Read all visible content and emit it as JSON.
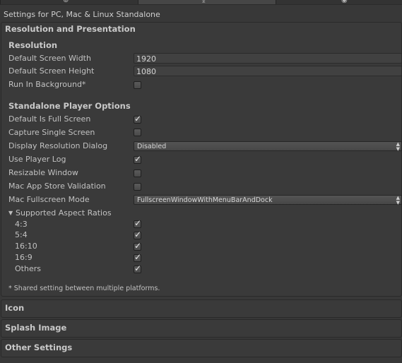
{
  "header": {
    "title": "Settings for PC, Mac & Linux Standalone"
  },
  "sections": {
    "resolution_presentation": "Resolution and Presentation",
    "icon": "Icon",
    "splash_image": "Splash Image",
    "other_settings": "Other Settings"
  },
  "resolution": {
    "heading": "Resolution",
    "default_width_label": "Default Screen Width",
    "default_width_value": "1920",
    "default_height_label": "Default Screen Height",
    "default_height_value": "1080",
    "run_in_background_label": "Run In Background*",
    "run_in_background": false
  },
  "standalone": {
    "heading": "Standalone Player Options",
    "default_full_screen_label": "Default Is Full Screen",
    "capture_single_screen_label": "Capture Single Screen",
    "display_resolution_dialog_label": "Display Resolution Dialog",
    "display_resolution_dialog_value": "Disabled",
    "use_player_log_label": "Use Player Log",
    "resizable_window_label": "Resizable Window",
    "mac_app_store_validation_label": "Mac App Store Validation",
    "mac_fullscreen_mode_label": "Mac Fullscreen Mode",
    "mac_fullscreen_mode_value": "FullscreenWindowWithMenuBarAndDock",
    "supported_aspect_ratios_label": "Supported Aspect Ratios",
    "aspect_ratios": [
      {
        "label": "4:3",
        "checked": true
      },
      {
        "label": "5:4",
        "checked": true
      },
      {
        "label": "16:10",
        "checked": true
      },
      {
        "label": "16:9",
        "checked": true
      },
      {
        "label": "Others",
        "checked": true
      }
    ]
  },
  "footnote": "* Shared setting between multiple platforms.",
  "icons": {
    "tab1": "globe-icon",
    "tab2": "download-icon",
    "tab3": "circle-icon",
    "checkmark": "checkmark-icon",
    "foldout": "triangle-down-icon"
  },
  "colors": {
    "background": "#383838",
    "panel": "#3a3a3a",
    "text": "#c2c2c2"
  }
}
